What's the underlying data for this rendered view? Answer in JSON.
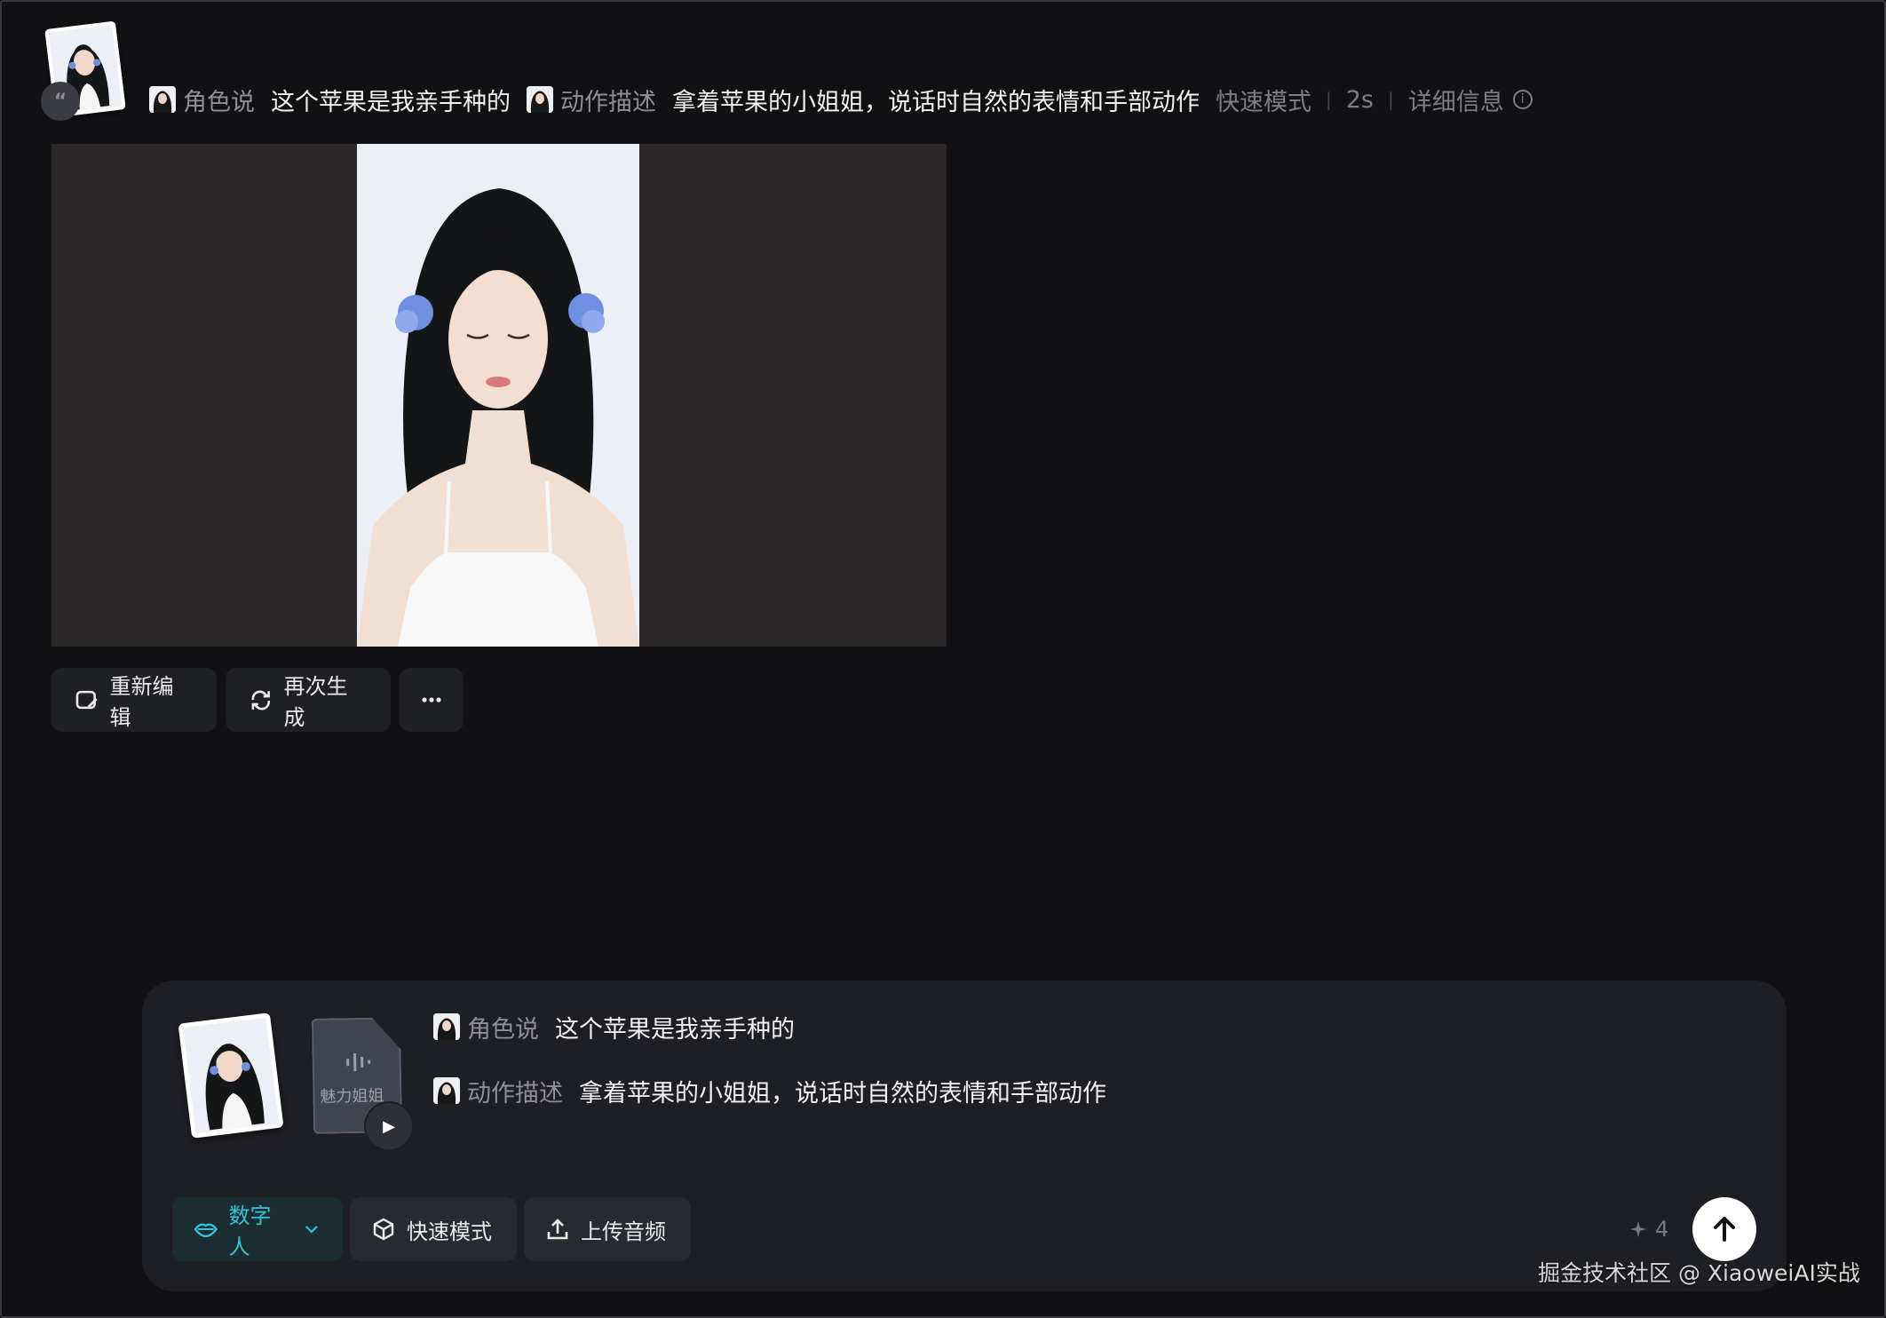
{
  "header": {
    "quote_glyph": "“",
    "role_label": "角色说",
    "role_text": "这个苹果是我亲手种的",
    "action_label": "动作描述",
    "action_text": "拿着苹果的小姐姐，说话时自然的表情和手部动作",
    "mode": "快速模式",
    "duration": "2s",
    "details": "详细信息",
    "info_glyph": "i"
  },
  "actions": {
    "re_edit": "重新编辑",
    "regenerate": "再次生成"
  },
  "composer": {
    "audio_label": "魅力姐姐",
    "role_label": "角色说",
    "role_text": "这个苹果是我亲手种的",
    "action_label": "动作描述",
    "action_text": "拿着苹果的小姐姐，说话时自然的表情和手部动作",
    "tools": {
      "digital_human": "数字人",
      "fast_mode": "快速模式",
      "upload_audio": "上传音频"
    },
    "credits": "4"
  },
  "watermark": "掘金技术社区 @ XiaoweiAI实战",
  "colors": {
    "background": "#111114",
    "accent": "#35c4d4",
    "panel": "#1e1f24"
  },
  "icons": [
    "quote-icon",
    "info-icon",
    "edit-icon",
    "refresh-icon",
    "more-icon",
    "lips-icon",
    "chevron-down-icon",
    "cube-icon",
    "upload-icon",
    "sparkle-icon",
    "arrow-up-icon",
    "play-icon",
    "waveform-icon"
  ]
}
